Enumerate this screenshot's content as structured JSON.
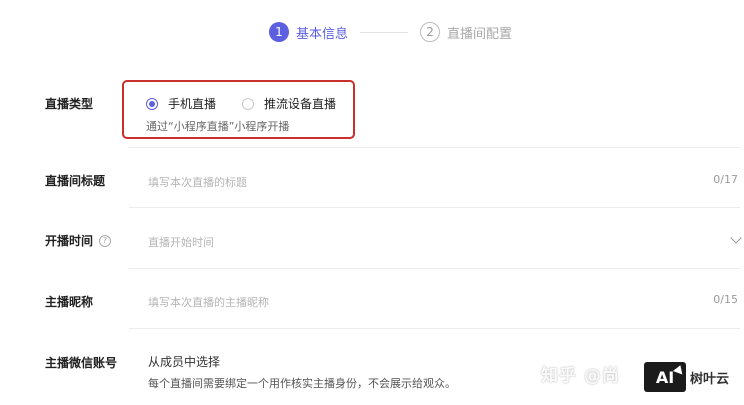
{
  "stepper": {
    "steps": [
      {
        "num": "1",
        "label": "基本信息"
      },
      {
        "num": "2",
        "label": "直播间配置"
      }
    ]
  },
  "form": {
    "live_type": {
      "label": "直播类型",
      "options": [
        "手机直播",
        "推流设备直播"
      ],
      "hint": "通过“小程序直播”小程序开播"
    },
    "title": {
      "label": "直播间标题",
      "placeholder": "填写本次直播的标题",
      "counter": "0/17"
    },
    "start_time": {
      "label": "开播时间",
      "placeholder": "直播开始时间"
    },
    "host_nickname": {
      "label": "主播昵称",
      "placeholder": "填写本次直播的主播昵称",
      "counter": "0/15"
    },
    "host_wechat": {
      "label": "主播微信账号",
      "value": "从成员中选择",
      "hint": "每个直播间需要绑定一个用作核实主播身份，不会展示给观众。"
    }
  },
  "watermark": {
    "text": "知乎 @尚",
    "badge_logo": "AI",
    "badge_name": "树叶云"
  }
}
